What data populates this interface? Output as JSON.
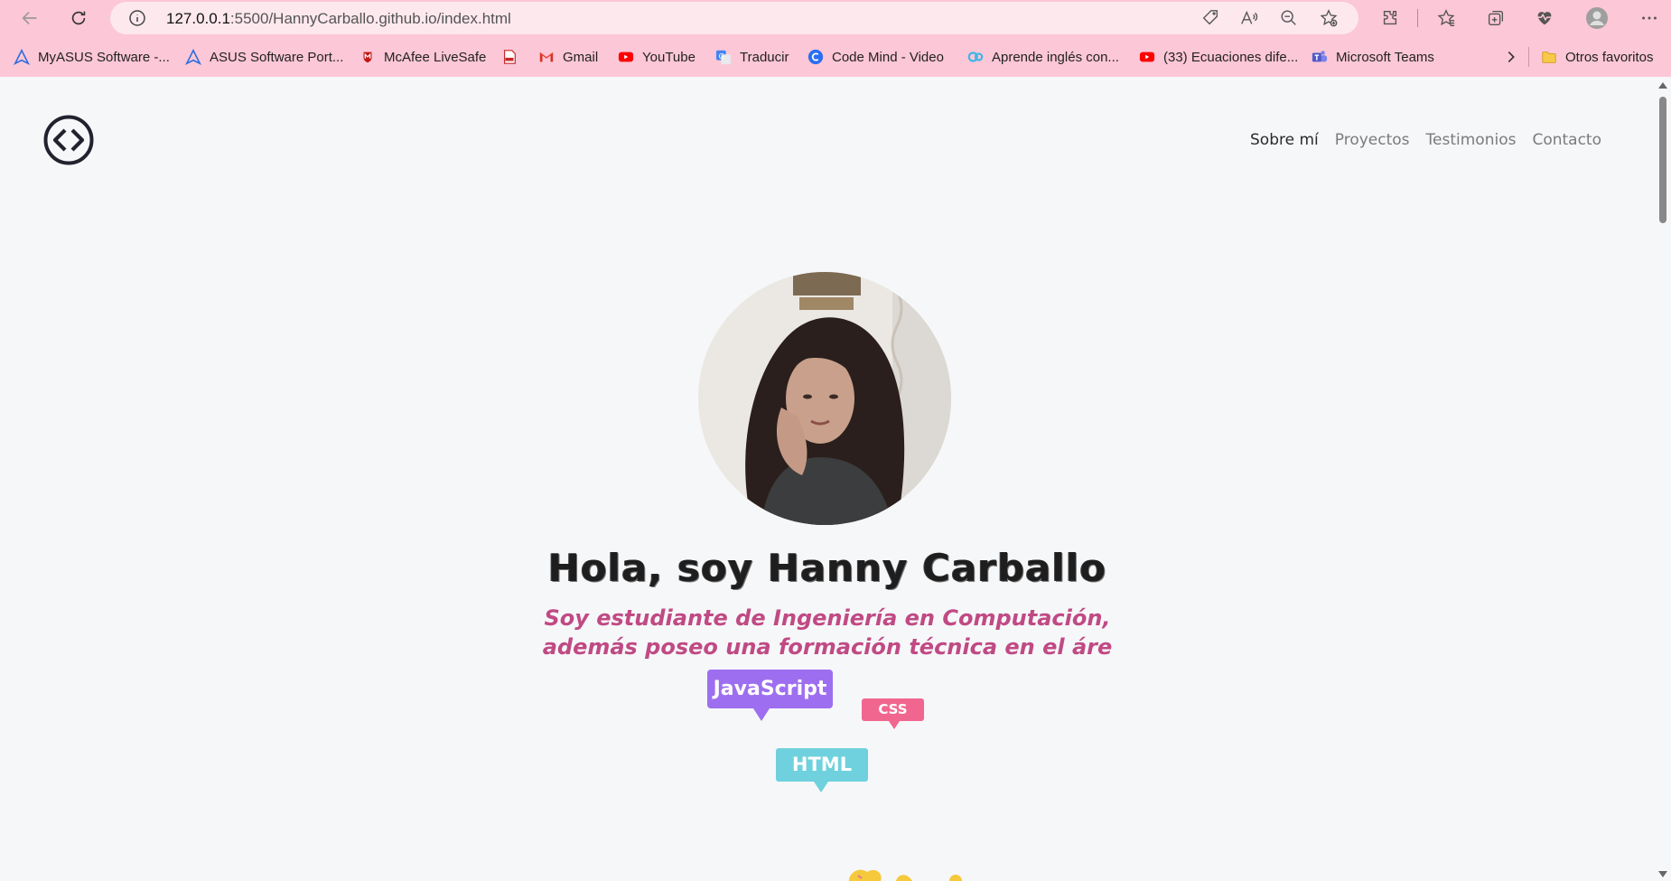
{
  "browser": {
    "url_host": "127.0.0.1",
    "url_rest": ":5500/HannyCarballo.github.io/index.html",
    "icons": [
      "back-icon",
      "reload-icon",
      "site-info-icon",
      "tag-icon",
      "read-aloud-icon",
      "zoom-out-icon",
      "add-favorite-icon",
      "extensions-icon",
      "favorites-icon",
      "collections-icon",
      "browser-essentials-icon",
      "profile-icon",
      "more-icon"
    ]
  },
  "bookmarks": [
    {
      "label": "MyASUS Software -...",
      "icon": "asus-icon"
    },
    {
      "label": "ASUS Software Port...",
      "icon": "asus-icon"
    },
    {
      "label": "McAfee LiveSafe",
      "icon": "mcafee-icon"
    },
    {
      "label": "",
      "icon": "pdf-icon"
    },
    {
      "label": "Gmail",
      "icon": "gmail-icon"
    },
    {
      "label": "YouTube",
      "icon": "youtube-icon"
    },
    {
      "label": "Traducir",
      "icon": "translate-icon"
    },
    {
      "label": "Code Mind - Video",
      "icon": "codemind-icon"
    },
    {
      "label": "Aprende inglés con...",
      "icon": "gc-icon"
    },
    {
      "label": "(33) Ecuaciones dife...",
      "icon": "youtube-icon"
    },
    {
      "label": "Microsoft Teams",
      "icon": "teams-icon"
    }
  ],
  "bookmarks_other": "Otros favoritos",
  "nav": {
    "items": [
      "Sobre mí",
      "Proyectos",
      "Testimonios",
      "Contacto"
    ]
  },
  "hero": {
    "title": "Hola, soy Hanny Carballo",
    "subtitle_line1": "Soy estudiante de Ingeniería en Computación,",
    "subtitle_line2": "además poseo una formación técnica en el áre"
  },
  "tags": {
    "js": "JavaScript",
    "css": "CSS",
    "html": "HTML"
  },
  "colors": {
    "chrome": "#fcc7d7",
    "page_bg": "#f6f7f9",
    "subtitle": "#c04a84",
    "tag_js": "#9d6ff0",
    "tag_css": "#f1668f",
    "tag_html": "#6fd1dd"
  }
}
